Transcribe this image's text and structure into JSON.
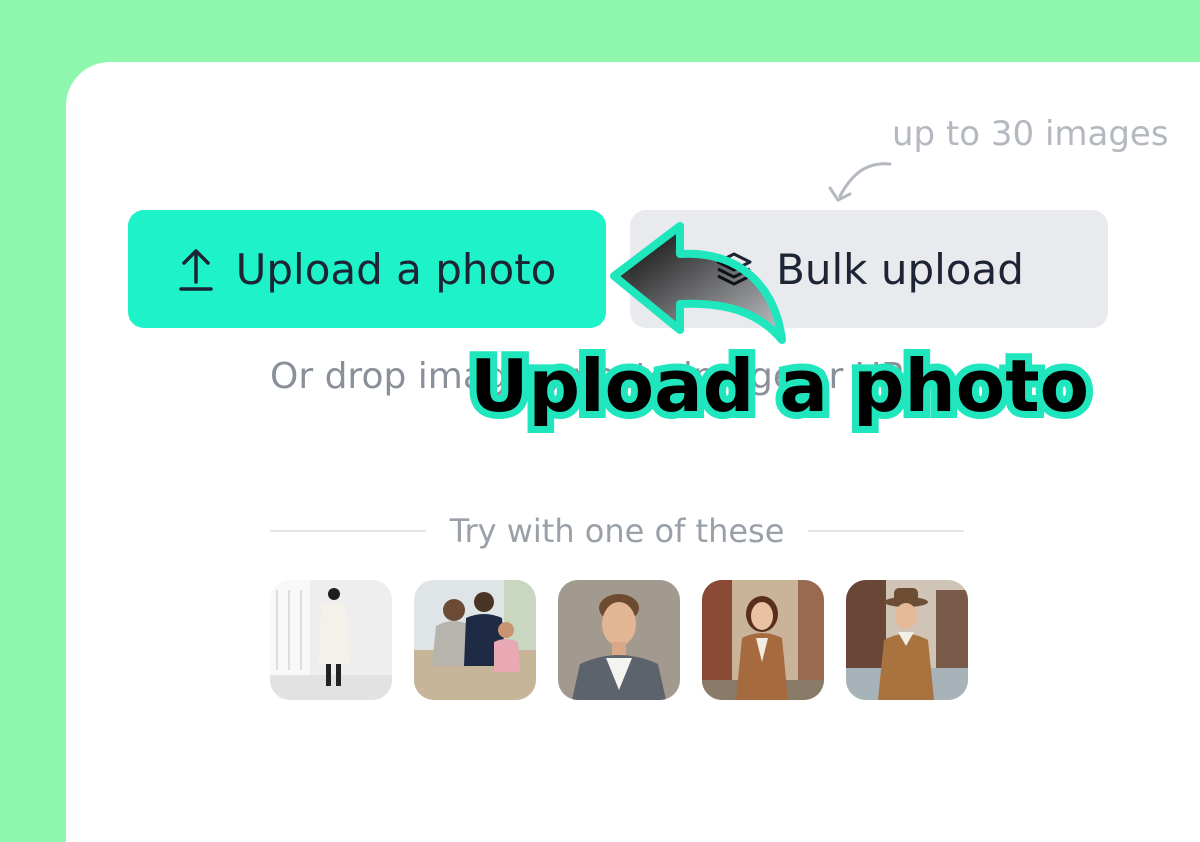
{
  "hint": {
    "text": "up to 30 images"
  },
  "buttons": {
    "upload": {
      "label": "Upload a photo",
      "icon": "upload-icon",
      "color": "#1ef2c8"
    },
    "bulk": {
      "label": "Bulk upload",
      "icon": "layers-icon",
      "color": "#e8eaee"
    }
  },
  "drop": {
    "text": "Or drop images, paste image or URL"
  },
  "callout": {
    "text": "Upload a photo",
    "stroke_color": "#20e6be"
  },
  "samples": {
    "heading": "Try with one of these",
    "items": [
      {
        "name": "woman-white-coat-photo"
      },
      {
        "name": "family-sofa-photo"
      },
      {
        "name": "man-denim-jacket-photo"
      },
      {
        "name": "woman-brown-coat-photo"
      },
      {
        "name": "man-fedora-hat-photo"
      }
    ]
  },
  "colors": {
    "page_background": "#8ff7ad",
    "card": "#ffffff",
    "accent": "#1ef2c8"
  }
}
